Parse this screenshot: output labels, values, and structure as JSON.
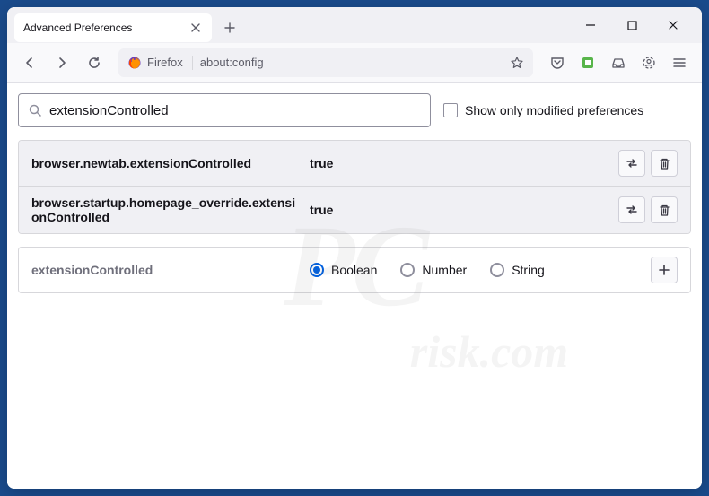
{
  "window": {
    "tab_title": "Advanced Preferences"
  },
  "toolbar": {
    "identity_label": "Firefox",
    "url": "about:config"
  },
  "search": {
    "value": "extensionControlled",
    "show_modified_label": "Show only modified preferences"
  },
  "prefs": [
    {
      "name": "browser.newtab.extensionControlled",
      "value": "true"
    },
    {
      "name": "browser.startup.homepage_override.extensionControlled",
      "value": "true"
    }
  ],
  "new_pref": {
    "name": "extensionControlled",
    "types": {
      "boolean": "Boolean",
      "number": "Number",
      "string": "String"
    },
    "selected": "boolean"
  },
  "watermark": {
    "main": "PC",
    "sub": "risk.com"
  }
}
